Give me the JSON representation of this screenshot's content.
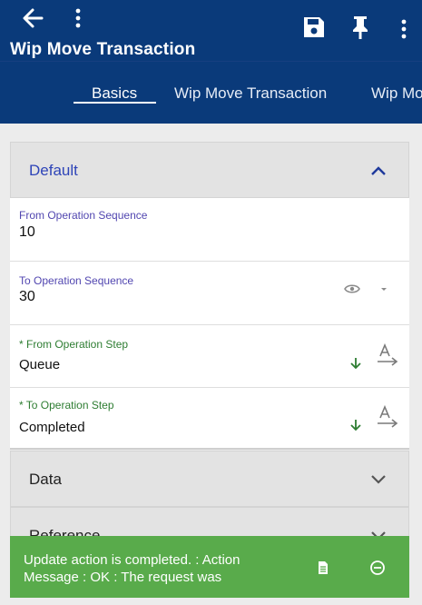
{
  "app_bar": {
    "title": "Wip Move Transaction"
  },
  "tabs": [
    {
      "label": "Basics"
    },
    {
      "label": "Wip Move Transaction"
    },
    {
      "label": "Wip Move Transaction Details"
    }
  ],
  "sections": {
    "default": {
      "title": "Default"
    },
    "data": {
      "title": "Data"
    },
    "reference": {
      "title": "Reference"
    }
  },
  "fields": {
    "from_operation_sequence": {
      "label": "From Operation Sequence",
      "value": "10"
    },
    "to_operation_sequence": {
      "label": "To Operation Sequence",
      "value": "30"
    },
    "from_operation_step": {
      "label": "* From Operation Step",
      "value": "Queue"
    },
    "to_operation_step": {
      "label": "* To Operation Step",
      "value": "Completed"
    }
  },
  "toast": {
    "message": "Update action is completed.  : Action Message : OK : The request was"
  },
  "colors": {
    "app_bar": "#0a3a7a",
    "section_title_active": "#2f45b8",
    "label_purple": "#5146b0",
    "label_green": "#2e7d32",
    "toast_bg": "#59ab4b"
  },
  "icons": [
    "back-arrow-icon",
    "more-vert-icon",
    "save-icon",
    "pin-icon",
    "chevron-up-icon",
    "chevron-down-icon",
    "eye-icon",
    "dropdown-caret-icon",
    "arrow-down-icon",
    "text-format-icon",
    "document-icon",
    "dismiss-icon"
  ]
}
